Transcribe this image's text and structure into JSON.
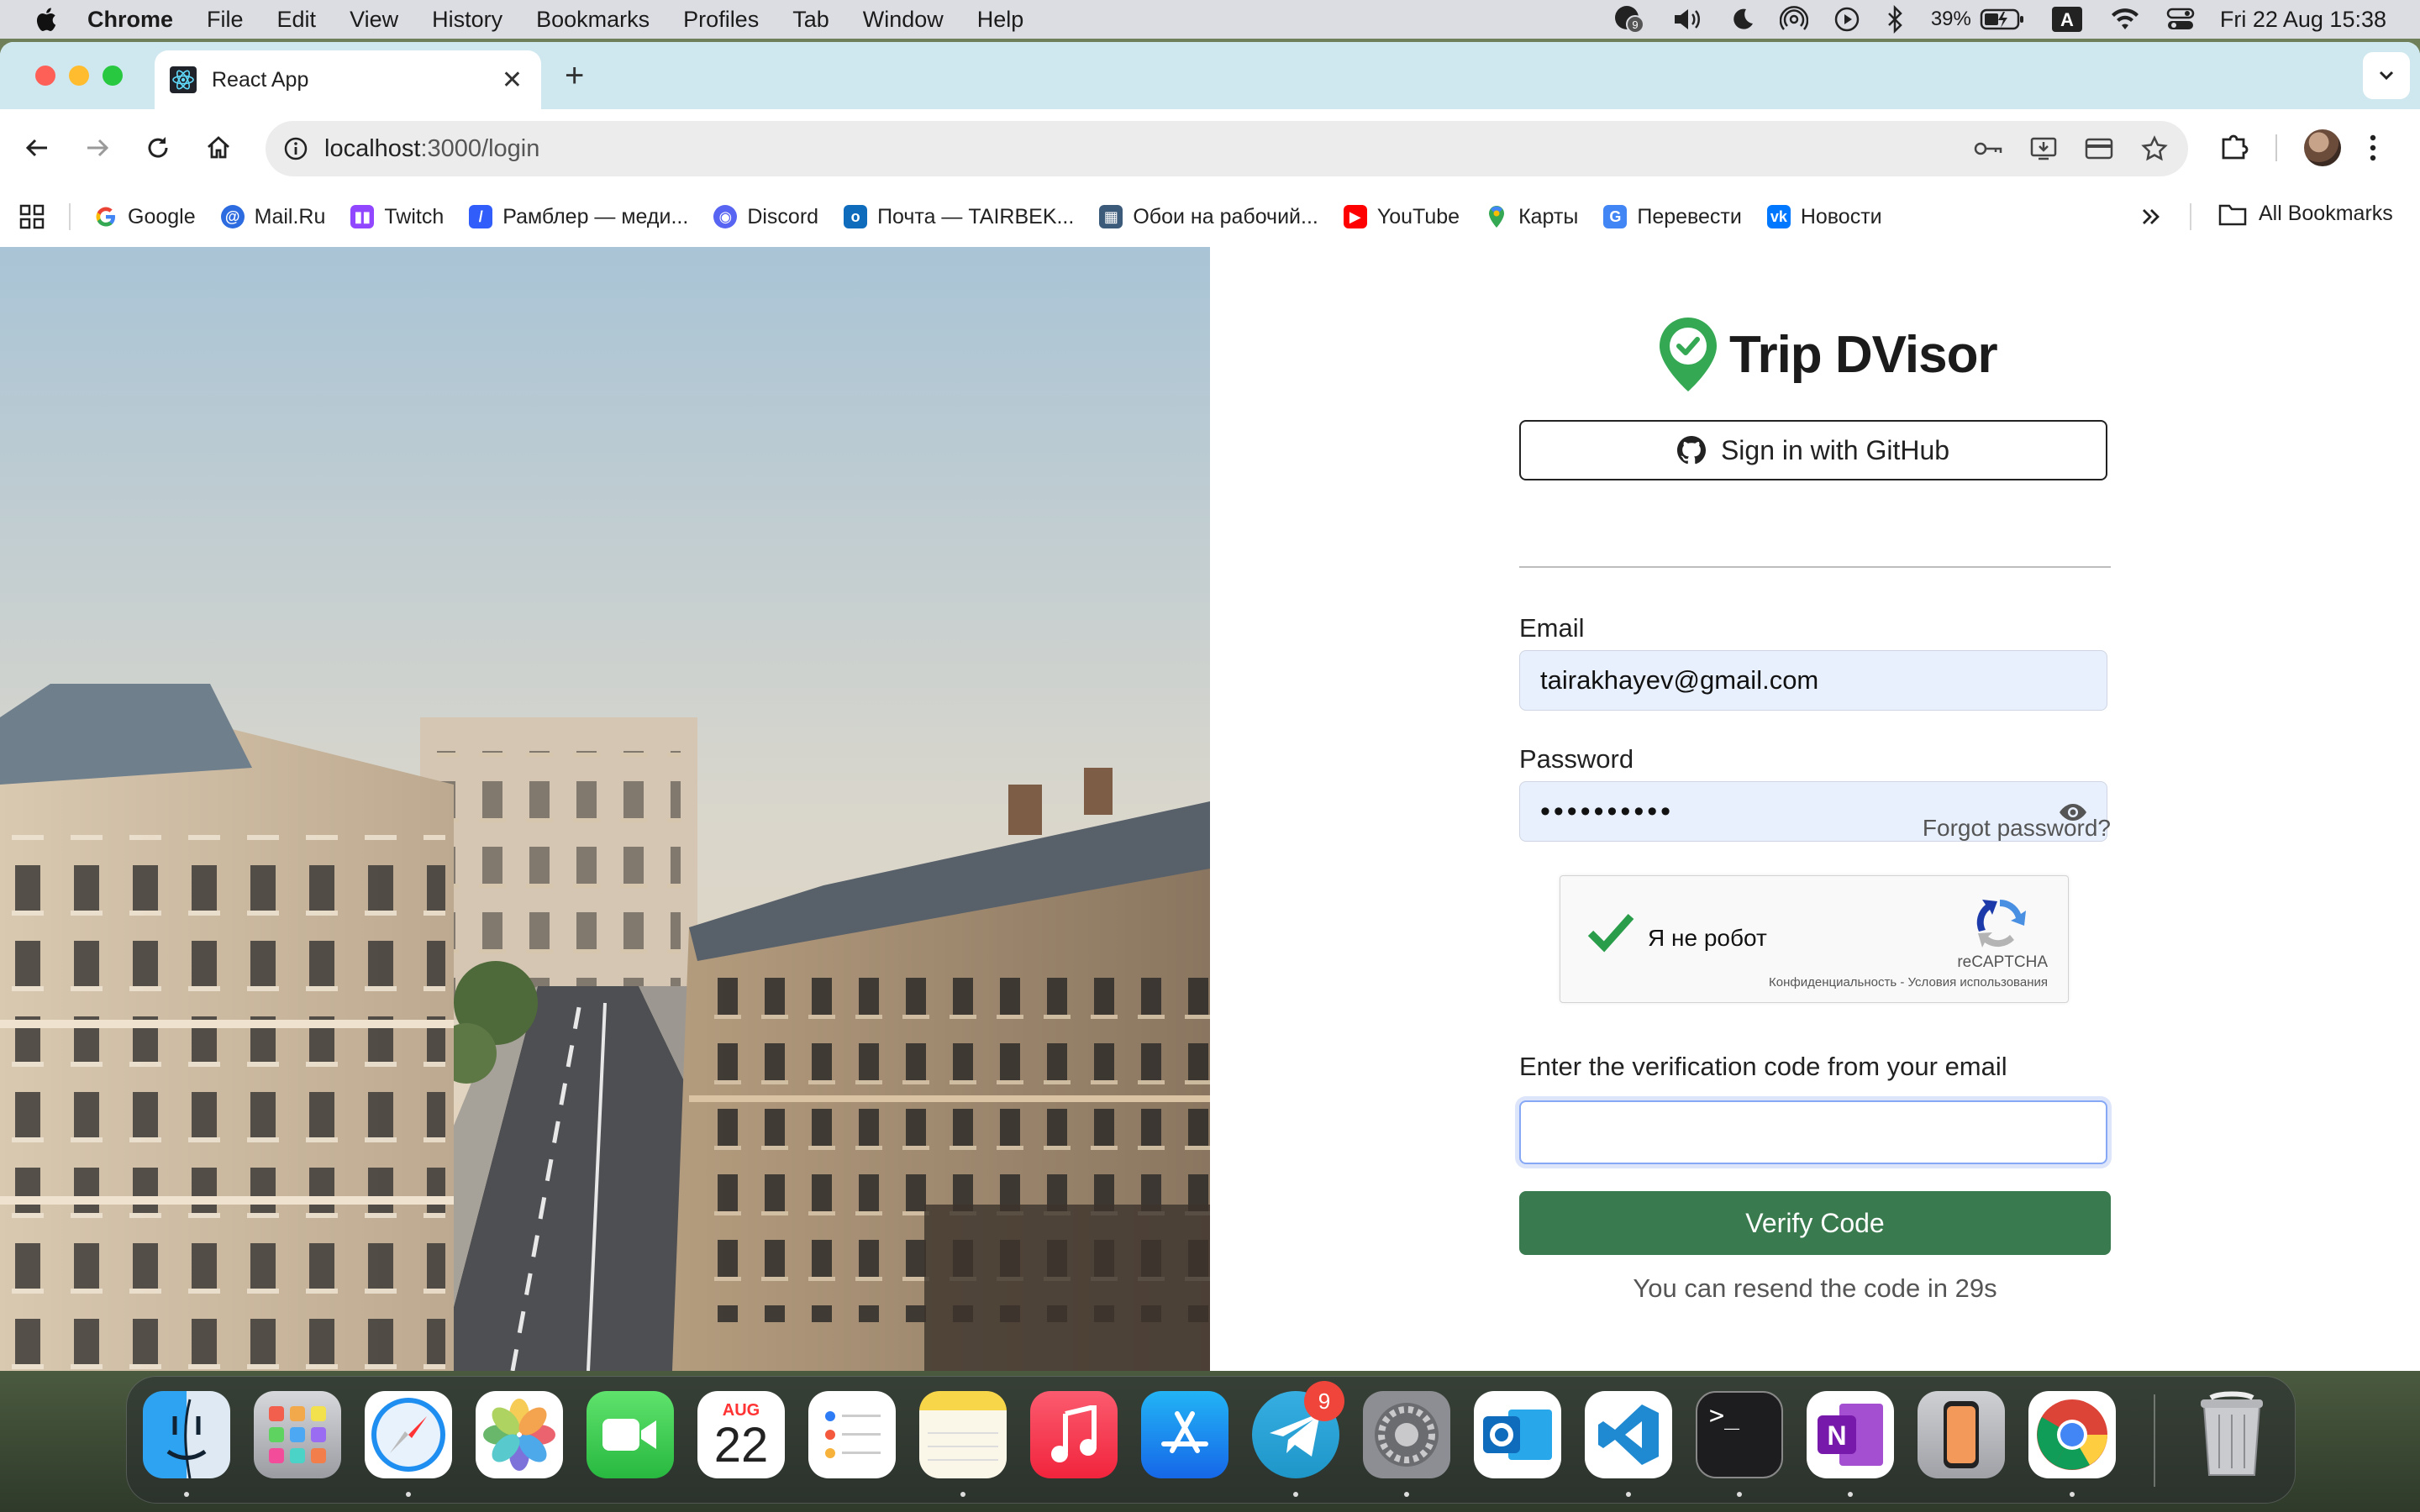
{
  "menubar": {
    "app": "Chrome",
    "items": [
      "File",
      "Edit",
      "View",
      "History",
      "Bookmarks",
      "Profiles",
      "Tab",
      "Window",
      "Help"
    ],
    "notification_count": "9",
    "battery": "39%",
    "input_source": "A",
    "clock": "Fri 22 Aug  15:38"
  },
  "browser": {
    "tab_title": "React App",
    "url_host": "localhost",
    "url_path": ":3000/login",
    "bookmarks": [
      {
        "label": "Google",
        "icon": "google-icon",
        "color": "#ffffff"
      },
      {
        "label": "Mail.Ru",
        "icon": "mailru-icon",
        "color": "#2c6be0"
      },
      {
        "label": "Twitch",
        "icon": "twitch-icon",
        "color": "#9146ff"
      },
      {
        "label": "Рамблер — меди...",
        "icon": "rambler-icon",
        "color": "#315efb"
      },
      {
        "label": "Discord",
        "icon": "discord-icon",
        "color": "#5865f2"
      },
      {
        "label": "Почта — TAIRBEK...",
        "icon": "outlook-icon",
        "color": "#0f6cbd"
      },
      {
        "label": "Обои на рабочий...",
        "icon": "wallpaper-icon",
        "color": "#3c5a7a"
      },
      {
        "label": "YouTube",
        "icon": "youtube-icon",
        "color": "#ff0000"
      },
      {
        "label": "Карты",
        "icon": "maps-icon",
        "color": "#34a853"
      },
      {
        "label": "Перевести",
        "icon": "translate-icon",
        "color": "#4285f4"
      },
      {
        "label": "Новости",
        "icon": "vk-icon",
        "color": "#0077ff"
      }
    ],
    "all_bookmarks": "All Bookmarks"
  },
  "login": {
    "brand": "Trip DVisor",
    "github_button": "Sign in with GitHub",
    "email_label": "Email",
    "email_value": "tairakhayev@gmail.com",
    "password_label": "Password",
    "password_value": "••••••••••",
    "forgot": "Forgot password?",
    "captcha_text": "Я не робот",
    "captcha_brand": "reCAPTCHA",
    "captcha_terms": "Конфиденциальность - Условия использования",
    "code_label": "Enter the verification code from your email",
    "code_value": "",
    "verify_button": "Verify Code",
    "resend_text": "You can resend the code in 29s"
  },
  "dock": {
    "calendar_month": "AUG",
    "calendar_day": "22",
    "telegram_badge": "9",
    "apps": [
      "Finder",
      "Launchpad",
      "Safari",
      "Photos",
      "FaceTime",
      "Calendar",
      "Reminders",
      "Notes",
      "Music",
      "App Store",
      "Telegram",
      "System Settings",
      "Outlook",
      "VS Code",
      "Terminal",
      "OneNote",
      "iPhone Mirroring",
      "Chrome",
      "Trash"
    ]
  },
  "colors": {
    "accent_green": "#3a7a4f",
    "autofill_blue": "#e8f0fe",
    "tabstrip": "#cfe8ef"
  }
}
